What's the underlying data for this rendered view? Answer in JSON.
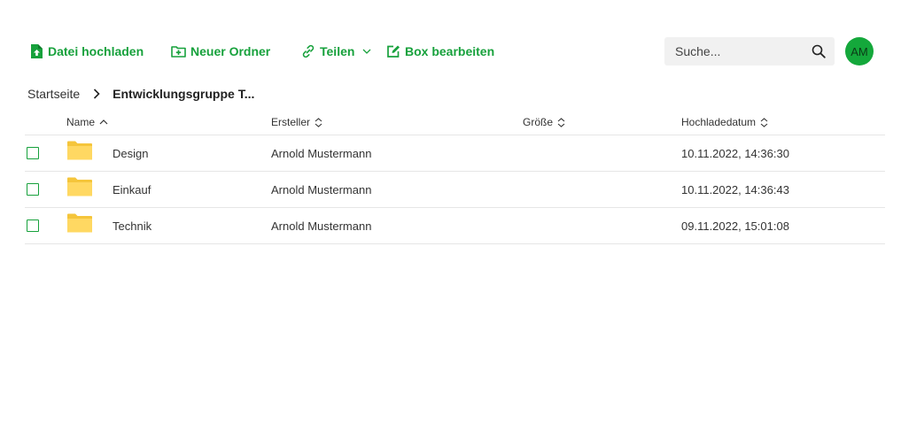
{
  "toolbar": {
    "upload_label": "Datei hochladen",
    "new_folder_label": "Neuer Ordner",
    "share_label": "Teilen",
    "edit_box_label": "Box bearbeiten"
  },
  "search": {
    "placeholder": "Suche..."
  },
  "user": {
    "initials": "AM"
  },
  "breadcrumb": {
    "home": "Startseite",
    "current": "Entwicklungsgruppe T..."
  },
  "table": {
    "headers": {
      "name": "Name",
      "creator": "Ersteller",
      "size": "Größe",
      "date": "Hochladedatum"
    },
    "rows": [
      {
        "name": "Design",
        "creator": "Arnold Mustermann",
        "size": "",
        "date": "10.11.2022, 14:36:30"
      },
      {
        "name": "Einkauf",
        "creator": "Arnold Mustermann",
        "size": "",
        "date": "10.11.2022, 14:36:43"
      },
      {
        "name": "Technik",
        "creator": "Arnold Mustermann",
        "size": "",
        "date": "09.11.2022, 15:01:08"
      }
    ]
  },
  "colors": {
    "accent": "#17a13c",
    "avatar_bg": "#14a83b",
    "folder": "#ffd45c",
    "search_bg": "#f1f1f1",
    "divider": "#e6e6e6"
  },
  "icons": {
    "upload": "file-upload-icon",
    "new_folder": "folder-plus-icon",
    "share": "link-icon",
    "edit": "edit-icon",
    "search": "search-icon",
    "folder": "folder-icon"
  }
}
